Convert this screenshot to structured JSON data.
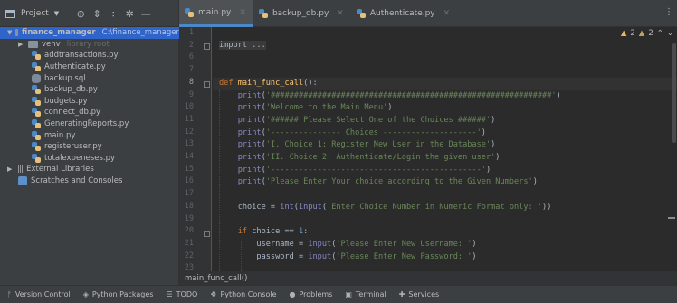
{
  "window": {
    "project_label": "Project"
  },
  "tabs": [
    {
      "label": "main.py",
      "active": true
    },
    {
      "label": "backup_db.py",
      "active": false
    },
    {
      "label": "Authenticate.py",
      "active": false
    }
  ],
  "project_tree": {
    "root": {
      "label": "finance_manager",
      "path": "C:\\finance_manager"
    },
    "venv": {
      "label": "venv",
      "note": "library root"
    },
    "files": [
      "addtransactions.py",
      "Authenticate.py",
      "backup.sql",
      "backup_db.py",
      "budgets.py",
      "connect_db.py",
      "GeneratingReports.py",
      "main.py",
      "registeruser.py",
      "totalexpeneses.py"
    ],
    "external_libraries": "External Libraries",
    "scratches": "Scratches and Consoles"
  },
  "editor": {
    "inspection": {
      "warnings": "2",
      "weak_warnings": "2"
    },
    "line_numbers": [
      "1",
      "2",
      "6",
      "7",
      "8",
      "9",
      "10",
      "11",
      "12",
      "13",
      "14",
      "15",
      "16",
      "17",
      "18",
      "19",
      "20",
      "21",
      "22",
      "23"
    ],
    "current_line": "8",
    "code_lines": [
      "",
      "import ...",
      "",
      "",
      "def main_func_call():",
      "    print('############################################################')",
      "    print('Welcome to the Main Menu')",
      "    print('###### Please Select One of the Choices ######')",
      "    print('--------------- Choices --------------------')",
      "    print('I. Choice 1: Register New User in the Database')",
      "    print('II. Choice 2: Authenticate/Login the given user')",
      "    print('---------------------------------------------')",
      "    print('Please Enter Your choice according to the Given Numbers')",
      "",
      "    choice = int(input('Enter Choice Number in Numeric Format only: '))",
      "",
      "    if choice == 1:",
      "        username = input('Please Enter New Username: ')",
      "        password = input('Please Enter New Password: ')"
    ]
  },
  "breadcrumb": "main_func_call()",
  "bottom_bar": [
    {
      "label": "Version Control",
      "icon": "branch-icon"
    },
    {
      "label": "Python Packages",
      "icon": "packages-icon"
    },
    {
      "label": "TODO",
      "icon": "list-icon"
    },
    {
      "label": "Python Console",
      "icon": "python-console-icon"
    },
    {
      "label": "Problems",
      "icon": "problems-icon"
    },
    {
      "label": "Terminal",
      "icon": "terminal-icon"
    },
    {
      "label": "Services",
      "icon": "services-icon"
    }
  ],
  "colors": {
    "accent": "#2f65ca",
    "tab_underline": "#4a88c7",
    "keyword": "#cc7832",
    "string": "#6a8759",
    "function": "#ffc66d"
  }
}
